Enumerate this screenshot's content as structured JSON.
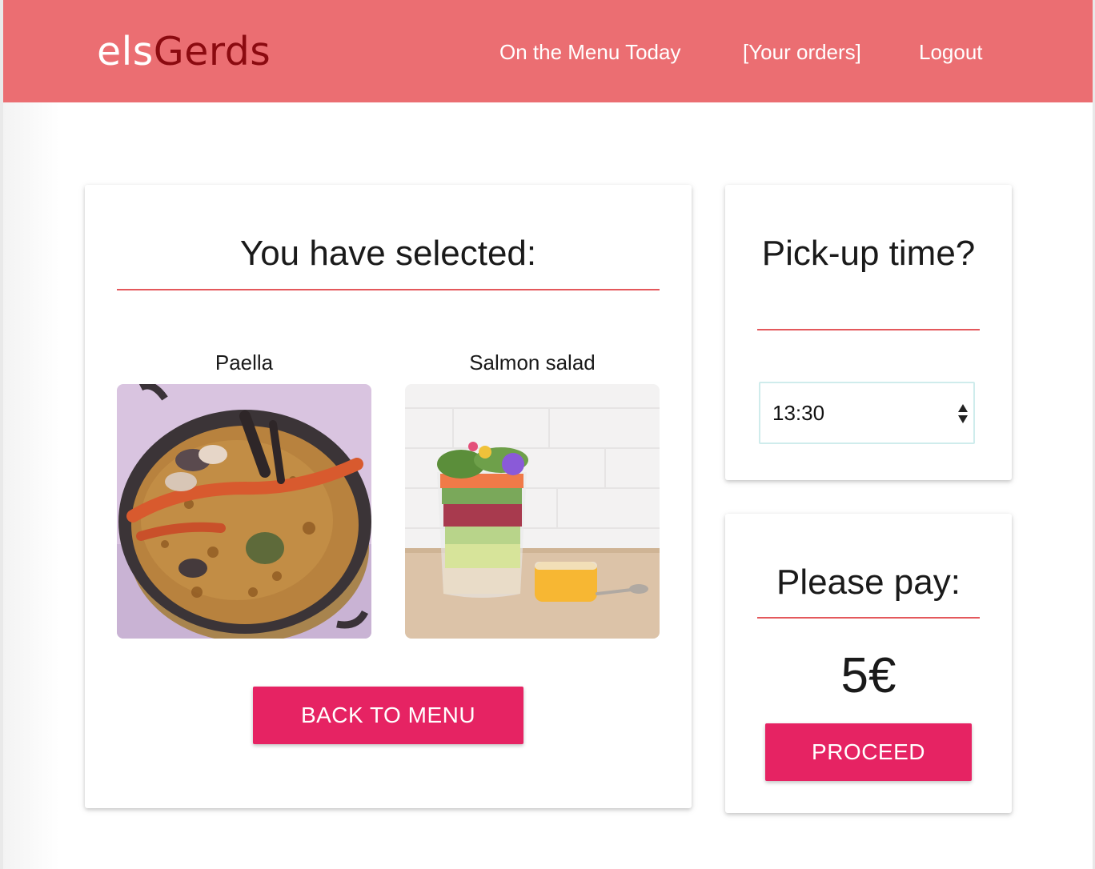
{
  "header": {
    "brand_part1": "els",
    "brand_part2": "Gerds",
    "nav": {
      "menu_today": "On the Menu Today",
      "your_orders": "[Your orders]",
      "logout": "Logout"
    }
  },
  "selection": {
    "title": "You have selected:",
    "items": [
      {
        "name": "Paella"
      },
      {
        "name": "Salmon salad"
      }
    ],
    "back_button": "BACK TO MENU"
  },
  "pickup": {
    "title": "Pick-up time?",
    "selected_time": "13:30"
  },
  "payment": {
    "title": "Please pay:",
    "amount": "5€",
    "proceed_button": "PROCEED"
  },
  "colors": {
    "header_bg": "#eb6e72",
    "brand_accent": "#8b0a10",
    "button": "#e62363",
    "rule": "#e4585c"
  }
}
